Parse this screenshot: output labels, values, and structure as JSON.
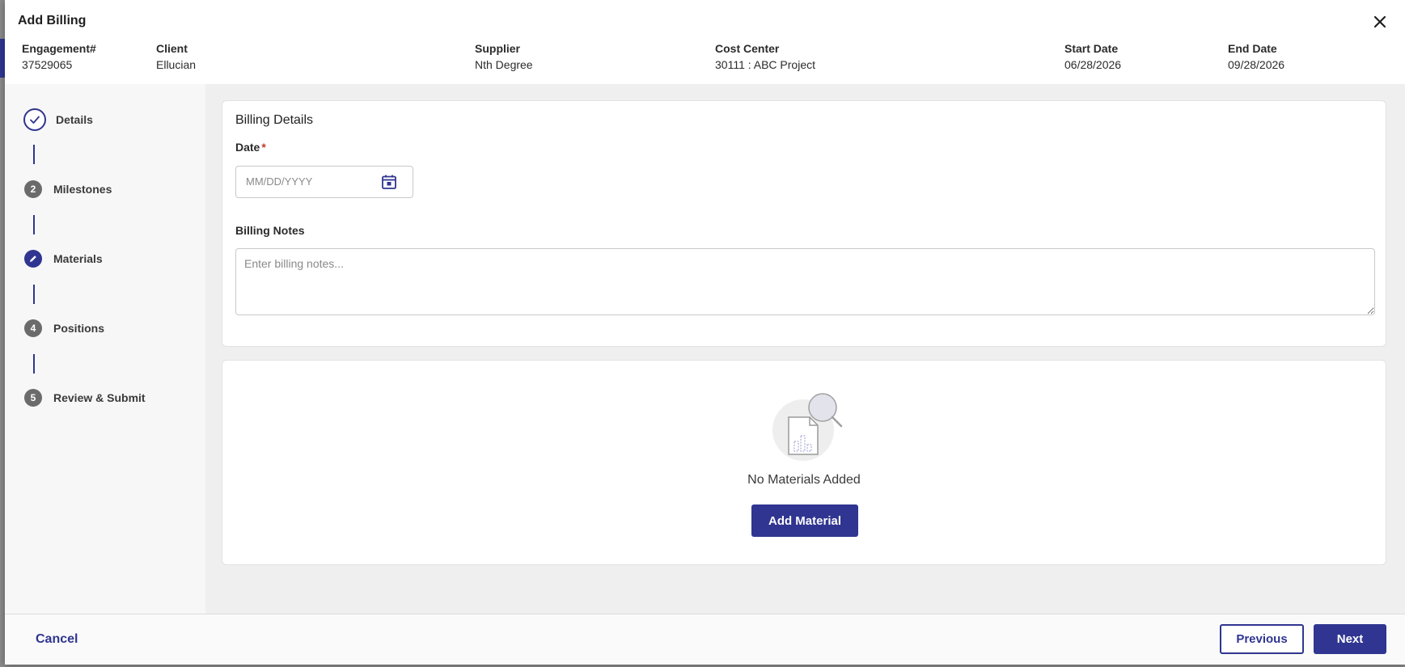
{
  "modal": {
    "title": "Add Billing"
  },
  "engagement": [
    {
      "label": "Engagement#",
      "value": "37529065"
    },
    {
      "label": "Client",
      "value": "Ellucian"
    },
    {
      "label": "Supplier",
      "value": "Nth Degree"
    },
    {
      "label": "Cost Center",
      "value": "30111 : ABC Project"
    },
    {
      "label": "Start Date",
      "value": "06/28/2026"
    },
    {
      "label": "End Date",
      "value": "09/28/2026"
    }
  ],
  "steps": [
    {
      "label": "Details",
      "state": "completed",
      "icon": "check-icon"
    },
    {
      "label": "Milestones",
      "state": "pending",
      "number": "2"
    },
    {
      "label": "Materials",
      "state": "active",
      "icon": "pencil-icon"
    },
    {
      "label": "Positions",
      "state": "pending",
      "number": "4"
    },
    {
      "label": "Review & Submit",
      "state": "pending",
      "number": "5"
    }
  ],
  "billing_details": {
    "title": "Billing Details",
    "date_label": "Date",
    "date_required_mark": "*",
    "date_placeholder": "MM/DD/YYYY",
    "notes_label": "Billing Notes",
    "notes_placeholder": "Enter billing notes..."
  },
  "materials": {
    "empty_text": "No Materials Added",
    "add_button": "Add Material"
  },
  "footer": {
    "cancel": "Cancel",
    "previous": "Previous",
    "next": "Next"
  },
  "colors": {
    "accent": "#2f3590",
    "required": "#c0392b",
    "step_pending": "#6b6b6b"
  }
}
